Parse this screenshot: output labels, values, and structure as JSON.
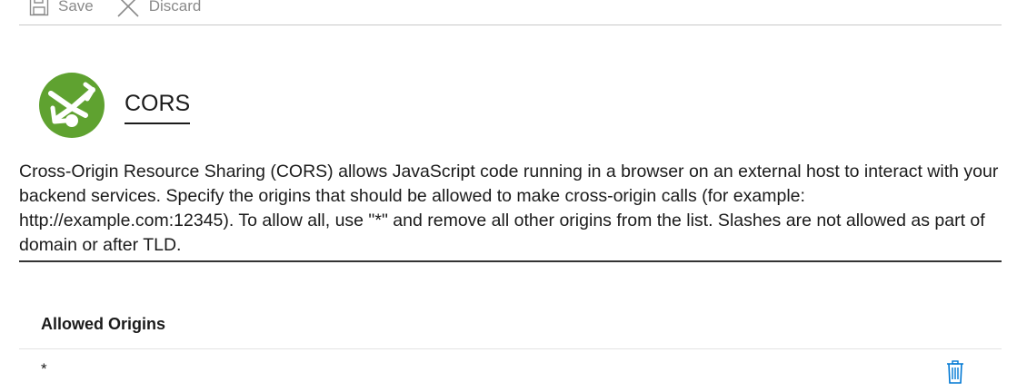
{
  "toolbar": {
    "save_label": "Save",
    "discard_label": "Discard",
    "icons": [
      "save-icon",
      "discard-icon"
    ]
  },
  "hero": {
    "title": "CORS",
    "logo_icon": "cors-logo-icon"
  },
  "description": "Cross-Origin Resource Sharing (CORS) allows JavaScript code running in a browser on an external host to interact with your backend services. Specify the origins that should be allowed to make cross-origin calls (for example: http://example.com:12345). To allow all, use \"*\" and remove all other origins from the list. Slashes are not allowed as part of domain or after TLD.",
  "table": {
    "column_header": "Allowed Origins",
    "rows": [
      {
        "origin": "*",
        "action_icon": "trash-icon"
      }
    ]
  },
  "colors": {
    "logo_green": "#5fa230",
    "delete_blue": "#0078d4",
    "toolbar_gray": "#8a8a8a"
  }
}
